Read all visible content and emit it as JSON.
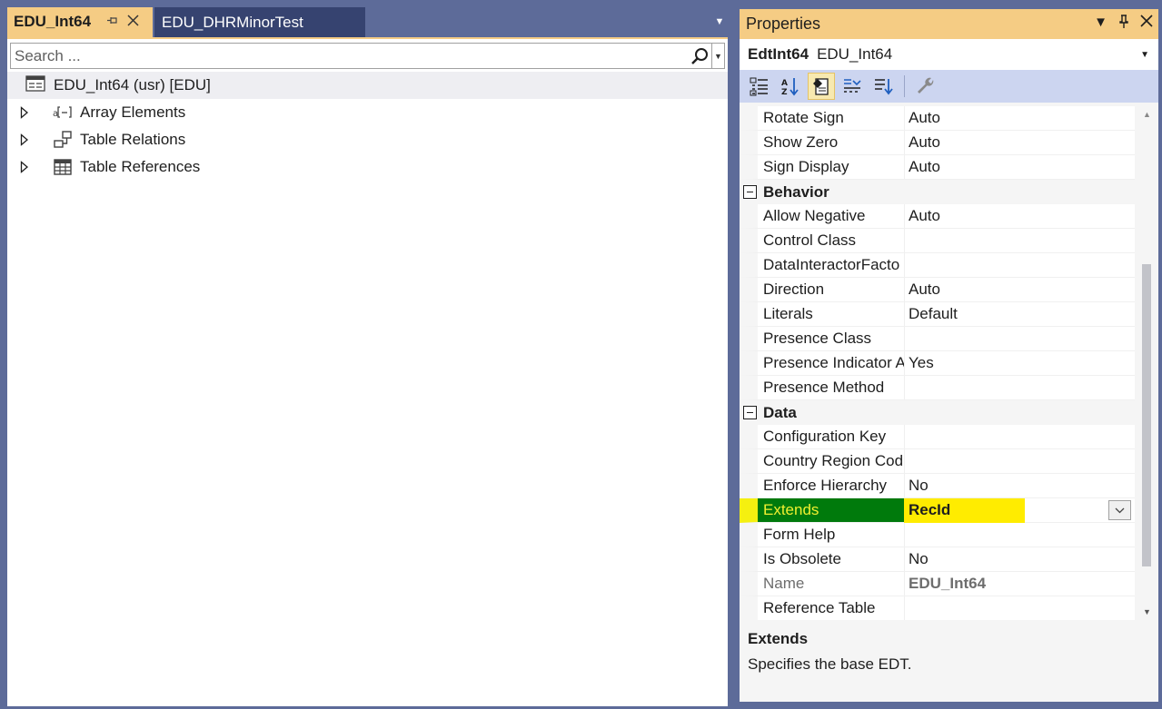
{
  "editor": {
    "tabs": [
      {
        "label": "EDU_Int64",
        "active": true
      },
      {
        "label": "EDU_DHRMinorTest",
        "active": false
      }
    ],
    "search": {
      "placeholder": "Search ...",
      "value": ""
    },
    "tree": {
      "root": "EDU_Int64 (usr) [EDU]",
      "items": [
        {
          "label": "Array Elements",
          "icon": "array-elements-icon"
        },
        {
          "label": "Table Relations",
          "icon": "table-relations-icon"
        },
        {
          "label": "Table References",
          "icon": "table-references-icon"
        }
      ]
    }
  },
  "properties": {
    "title": "Properties",
    "object_type": "EdtInt64",
    "object_name": "EDU_Int64",
    "rows": [
      {
        "kind": "prop",
        "name": "Rotate Sign",
        "value": "Auto"
      },
      {
        "kind": "prop",
        "name": "Show Zero",
        "value": "Auto"
      },
      {
        "kind": "prop",
        "name": "Sign Display",
        "value": "Auto"
      },
      {
        "kind": "category",
        "name": "Behavior"
      },
      {
        "kind": "prop",
        "name": "Allow Negative",
        "value": "Auto"
      },
      {
        "kind": "prop",
        "name": "Control Class",
        "value": ""
      },
      {
        "kind": "prop",
        "name": "DataInteractorFacto",
        "value": ""
      },
      {
        "kind": "prop",
        "name": "Direction",
        "value": "Auto"
      },
      {
        "kind": "prop",
        "name": "Literals",
        "value": "Default"
      },
      {
        "kind": "prop",
        "name": "Presence Class",
        "value": ""
      },
      {
        "kind": "prop",
        "name": "Presence Indicator A",
        "value": "Yes"
      },
      {
        "kind": "prop",
        "name": "Presence Method",
        "value": ""
      },
      {
        "kind": "category",
        "name": "Data"
      },
      {
        "kind": "prop",
        "name": "Configuration Key",
        "value": ""
      },
      {
        "kind": "prop",
        "name": "Country Region Cod",
        "value": ""
      },
      {
        "kind": "prop",
        "name": "Enforce Hierarchy",
        "value": "No"
      },
      {
        "kind": "prop",
        "name": "Extends",
        "value": "RecId",
        "selected": true
      },
      {
        "kind": "prop",
        "name": "Form Help",
        "value": ""
      },
      {
        "kind": "prop",
        "name": "Is Obsolete",
        "value": "No"
      },
      {
        "kind": "prop",
        "name": "Name",
        "value": "EDU_Int64",
        "readonly": true
      },
      {
        "kind": "prop",
        "name": "Reference Table",
        "value": ""
      }
    ],
    "description": {
      "title": "Extends",
      "text": "Specifies the base EDT."
    }
  },
  "colors": {
    "accent": "#f5cc84",
    "frame": "#5d6b99",
    "inactive_tab": "#364370",
    "toolbar": "#ccd5f0",
    "selected_name_bg": "#007a0c",
    "selected_value_bg": "#ffec00"
  }
}
